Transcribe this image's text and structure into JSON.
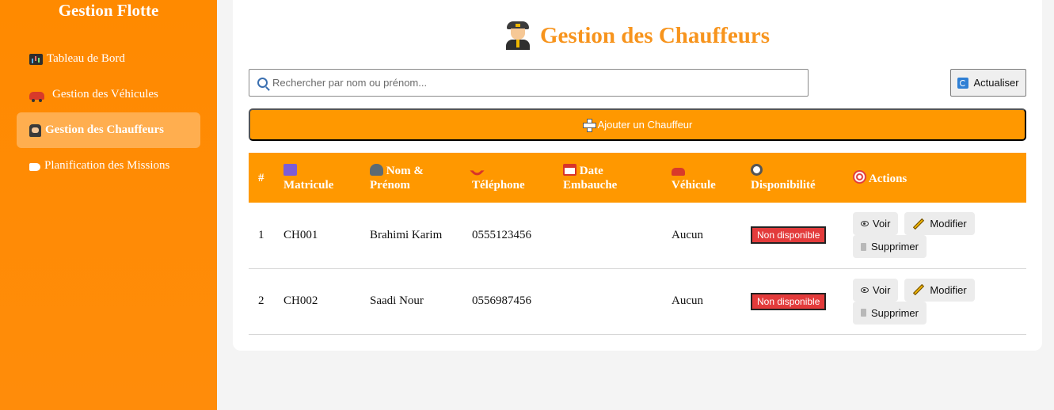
{
  "sidebar": {
    "brand": "Gestion Flotte",
    "items": [
      {
        "label": "Tableau de Bord",
        "icon": "chart-icon",
        "active": false
      },
      {
        "label": "Gestion des Véhicules",
        "icon": "car-icon",
        "active": false
      },
      {
        "label": "Gestion des Chauffeurs",
        "icon": "driver-icon",
        "active": true
      },
      {
        "label": "Planification des Missions",
        "icon": "tag-icon",
        "active": false
      }
    ]
  },
  "main": {
    "title": "Gestion des Chauffeurs",
    "search_placeholder": "Rechercher par nom ou prénom...",
    "refresh_label": "Actualiser",
    "add_label": "Ajouter un Chauffeur",
    "table": {
      "headers": {
        "index": "#",
        "matricule": "Matricule",
        "nom_line1": "Nom &",
        "nom_line2": "Prénom",
        "telephone": "Téléphone",
        "date_line1": "Date",
        "date_line2": "Embauche",
        "vehicule": "Véhicule",
        "disponibilite": "Disponibilité",
        "actions": "Actions"
      },
      "rows": [
        {
          "index": "1",
          "matricule": "CH001",
          "nom": "Brahimi Karim",
          "telephone": "0555123456",
          "date": "",
          "vehicule": "Aucun",
          "disponibilite": "Non disponible"
        },
        {
          "index": "2",
          "matricule": "CH002",
          "nom": "Saadi Nour",
          "telephone": "0556987456",
          "date": "",
          "vehicule": "Aucun",
          "disponibilite": "Non disponible"
        }
      ],
      "actions": {
        "view": "Voir",
        "edit": "Modifier",
        "delete": "Supprimer"
      }
    }
  },
  "colors": {
    "accent": "#ff9800",
    "sidebar": "#ff8a00",
    "title": "#f7941d",
    "badge": "#e33b3b"
  }
}
